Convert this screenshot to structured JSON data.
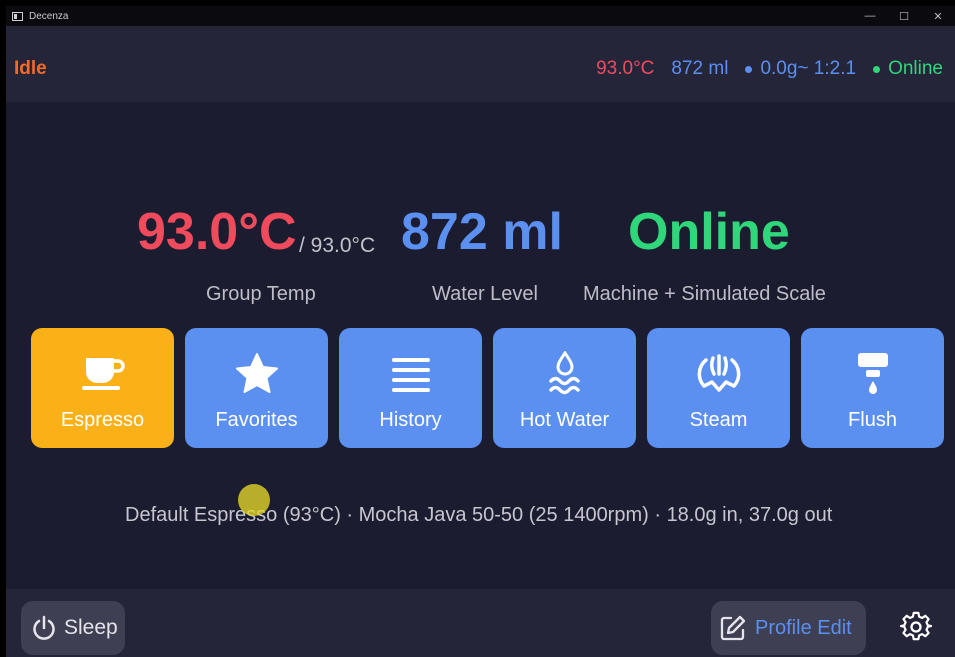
{
  "window": {
    "title": "Decenza",
    "controls": {
      "minimize": "—",
      "maximize": "☐",
      "close": "✕"
    }
  },
  "status": {
    "state": "Idle",
    "temp": "93.0°C",
    "water": "872 ml",
    "scale": "0.0g~ 1:2.1",
    "connection": "Online"
  },
  "readouts": {
    "temp": "93.0°C",
    "target": "/ 93.0°C",
    "water": "872 ml",
    "connection": "Online",
    "temp_label": "Group Temp",
    "water_label": "Water Level",
    "connection_label": "Machine + Simulated Scale"
  },
  "actions": [
    {
      "label": "Espresso",
      "icon": "coffee-cup-icon",
      "active": true
    },
    {
      "label": "Favorites",
      "icon": "star-icon",
      "active": false
    },
    {
      "label": "History",
      "icon": "list-icon",
      "active": false
    },
    {
      "label": "Hot Water",
      "icon": "hot-water-icon",
      "active": false
    },
    {
      "label": "Steam",
      "icon": "steam-icon",
      "active": false
    },
    {
      "label": "Flush",
      "icon": "flush-icon",
      "active": false
    }
  ],
  "profile_summary": "Default Espresso (93°C) · Mocha Java 50-50 (25 1400rpm) · 18.0g in, 37.0g out",
  "bottom": {
    "sleep_label": "Sleep",
    "profile_edit_label": "Profile Edit",
    "settings_icon": "gear-icon"
  },
  "colors": {
    "background": "#1b1c30",
    "bar": "#252539",
    "accent_blue": "#5b8ff0",
    "accent_orange": "#fab017",
    "temp_red": "#ef4b5d",
    "online_green": "#2fd67a",
    "idle_orange": "#f06a2a"
  }
}
